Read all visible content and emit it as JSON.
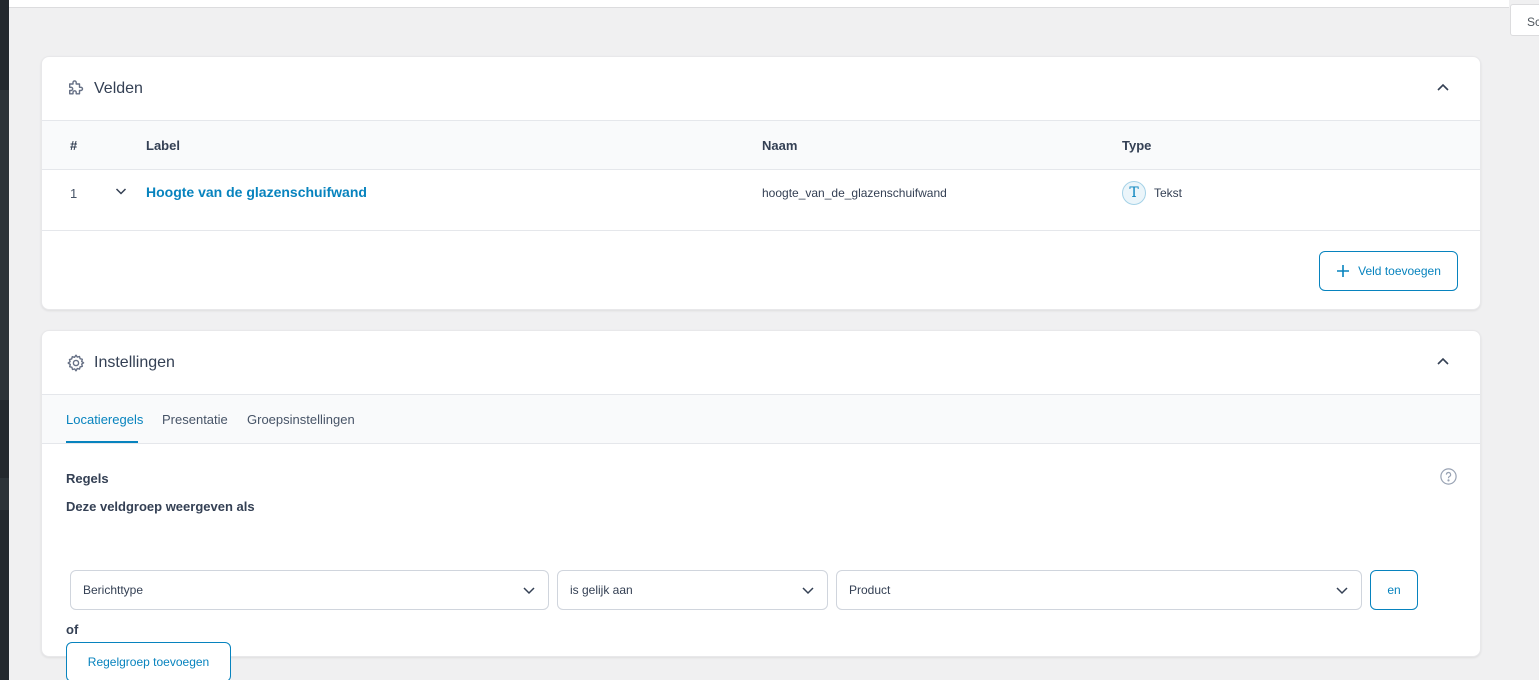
{
  "screen_options_label": "Sc",
  "fields_panel": {
    "title": "Velden",
    "icon": "puzzle-icon",
    "columns": {
      "num": "#",
      "label": "Label",
      "name": "Naam",
      "type": "Type"
    },
    "rows": [
      {
        "num": "1",
        "label": "Hoogte van de glazenschuifwand",
        "name": "hoogte_van_de_glazenschuifwand",
        "type": "Tekst",
        "type_icon_letter": "T"
      }
    ],
    "add_field_label": "Veld toevoegen"
  },
  "settings_panel": {
    "title": "Instellingen",
    "icon": "gear-icon",
    "tabs": [
      {
        "label": "Locatieregels",
        "active": true
      },
      {
        "label": "Presentatie",
        "active": false
      },
      {
        "label": "Groepsinstellingen",
        "active": false
      }
    ],
    "rules_heading": "Regels",
    "rules_subheading": "Deze veldgroep weergeven als",
    "rule": {
      "param": "Berichttype",
      "operator": "is gelijk aan",
      "value": "Product"
    },
    "and_label": "en",
    "or_label": "of",
    "add_rule_group_label": "Regelgroep toevoegen"
  },
  "colors": {
    "accent": "#0783be",
    "background": "#f0f0f1"
  }
}
